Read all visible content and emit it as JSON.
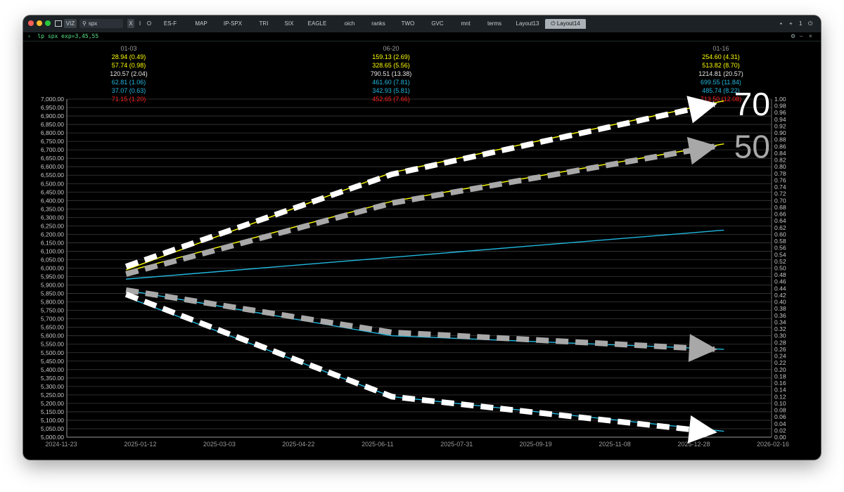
{
  "window": {
    "search_value": "spx",
    "viz_label": "VIZ",
    "mode_buttons": [
      "X",
      "I",
      "O"
    ],
    "tabs": [
      "ES-F",
      "MAP",
      "IP-SPX",
      "TRI",
      "SIX",
      "EAGLE",
      "oich",
      "ranks",
      "TWO",
      "GVC",
      "mnt",
      "terms",
      "Layout13",
      "Layout14"
    ],
    "active_tab": "Layout14",
    "right_controls": [
      "+",
      "1"
    ],
    "command": "lp spx exp=3,45,55",
    "colors": {
      "yellow": "#ffff00",
      "white": "#e6e6e6",
      "cyan": "#22b8e0",
      "red": "#ff2222",
      "accent_green": "#57e389"
    }
  },
  "chart_data": {
    "type": "line",
    "x_ticks": [
      "2024-11-23",
      "2025-01-12",
      "2025-03-03",
      "2025-04-22",
      "2025-06-11",
      "2025-07-31",
      "2025-09-19",
      "2025-11-08",
      "2025-12-28",
      "2026-02-16"
    ],
    "x_range": [
      "2024-11-23",
      "2026-02-16"
    ],
    "y_left_range": [
      5000,
      7000
    ],
    "y_left_step": 50,
    "y_right_range": [
      0,
      1
    ],
    "y_right_step": 0.02,
    "grid": true,
    "expiries": [
      {
        "date": "01-03",
        "rows": [
          {
            "text": "28.94 (0.49)",
            "color": "#ffff00"
          },
          {
            "text": "57.74 (0.98)",
            "color": "#ffff00"
          },
          {
            "text": "120.57 (2.04)",
            "color": "#e6e6e6"
          },
          {
            "text": "62.81 (1.06)",
            "color": "#22b8e0"
          },
          {
            "text": "37.07 (0.63)",
            "color": "#22b8e0"
          },
          {
            "text": "71.15 (1.20)",
            "color": "#ff2222"
          }
        ]
      },
      {
        "date": "06-20",
        "rows": [
          {
            "text": "159.13 (2.69)",
            "color": "#ffff00"
          },
          {
            "text": "328.65 (5.56)",
            "color": "#ffff00"
          },
          {
            "text": "790.51 (13.38)",
            "color": "#e6e6e6"
          },
          {
            "text": "461.60 (7.81)",
            "color": "#22b8e0"
          },
          {
            "text": "342.93 (5.81)",
            "color": "#22b8e0"
          },
          {
            "text": "452.65 (7.66)",
            "color": "#ff2222"
          }
        ]
      },
      {
        "date": "01-16",
        "rows": [
          {
            "text": "254.60 (4.31)",
            "color": "#ffff00"
          },
          {
            "text": "513.82 (8.70)",
            "color": "#ffff00"
          },
          {
            "text": "1214.81 (20.57)",
            "color": "#e6e6e6"
          },
          {
            "text": "699.55 (11.84)",
            "color": "#22b8e0"
          },
          {
            "text": "485.74 (8.22)",
            "color": "#22b8e0"
          },
          {
            "text": "713.50 (12.08)",
            "color": "#ff2222"
          }
        ]
      }
    ],
    "series": [
      {
        "color": "#ffff00",
        "points": [
          [
            "2025-01-03",
            5990
          ],
          [
            "2025-06-20",
            6565
          ],
          [
            "2026-01-16",
            6990
          ]
        ]
      },
      {
        "color": "#ffff00",
        "points": [
          [
            "2025-01-03",
            5980
          ],
          [
            "2025-06-20",
            6395
          ],
          [
            "2026-01-16",
            6735
          ]
        ]
      },
      {
        "color": "#22b8e0",
        "points": [
          [
            "2025-01-03",
            5935
          ],
          [
            "2026-01-16",
            6225
          ]
        ]
      },
      {
        "color": "#22b8e0",
        "points": [
          [
            "2025-01-03",
            5870
          ],
          [
            "2025-06-20",
            5600
          ],
          [
            "2026-01-16",
            5520
          ]
        ]
      },
      {
        "color": "#22b8e0",
        "points": [
          [
            "2025-01-03",
            5830
          ],
          [
            "2025-06-20",
            5240
          ],
          [
            "2026-01-16",
            5035
          ]
        ]
      }
    ],
    "annotations": [
      {
        "label": "70",
        "style": "dashed-white",
        "points": [
          [
            "2025-01-03",
            6010
          ],
          [
            "2025-06-20",
            6555
          ],
          [
            "2026-01-10",
            6970
          ]
        ]
      },
      {
        "label": "50",
        "style": "dashed-gray",
        "points": [
          [
            "2025-01-03",
            5965
          ],
          [
            "2025-06-20",
            6385
          ],
          [
            "2026-01-10",
            6720
          ]
        ]
      },
      {
        "label": "",
        "style": "dashed-gray",
        "points": [
          [
            "2025-01-03",
            5870
          ],
          [
            "2025-06-20",
            5620
          ],
          [
            "2026-01-10",
            5520
          ]
        ]
      },
      {
        "label": "",
        "style": "dashed-white",
        "points": [
          [
            "2025-01-03",
            5845
          ],
          [
            "2025-06-20",
            5240
          ],
          [
            "2026-01-10",
            5030
          ]
        ]
      }
    ]
  }
}
